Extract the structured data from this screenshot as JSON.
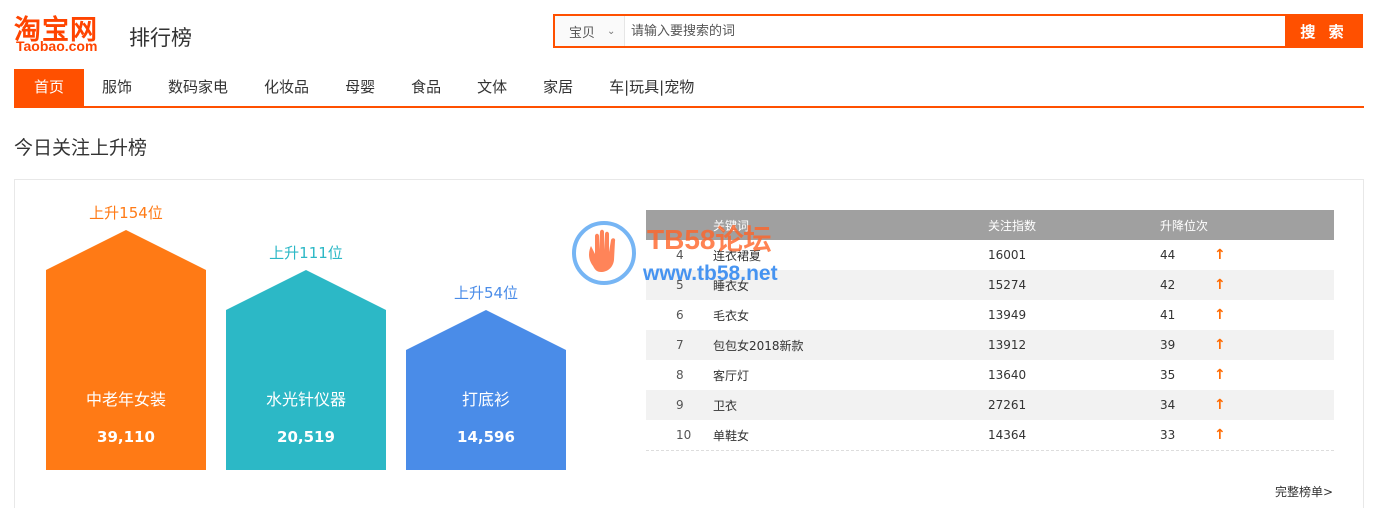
{
  "header": {
    "logo_cn": "淘宝网",
    "logo_en": "Taobao.com",
    "page_name": "排行榜",
    "search": {
      "type_label": "宝贝",
      "placeholder": "请输入要搜索的词",
      "button_label": "搜 索"
    }
  },
  "nav": {
    "items": [
      {
        "label": "首页"
      },
      {
        "label": "服饰"
      },
      {
        "label": "数码家电"
      },
      {
        "label": "化妆品"
      },
      {
        "label": "母婴"
      },
      {
        "label": "食品"
      },
      {
        "label": "文体"
      },
      {
        "label": "家居"
      },
      {
        "label": "车|玩具|宠物"
      }
    ]
  },
  "section": {
    "title": "今日关注上升榜"
  },
  "top3": [
    {
      "rise": "上升154位",
      "name": "中老年女装",
      "count": "39,110",
      "color": "#ff7a15"
    },
    {
      "rise": "上升111位",
      "name": "水光针仪器",
      "count": "20,519",
      "color": "#2cb8c6"
    },
    {
      "rise": "上升54位",
      "name": "打底衫",
      "count": "14,596",
      "color": "#4a8ce8"
    }
  ],
  "table": {
    "headers": [
      "关键词",
      "关注指数",
      "升降位次"
    ],
    "rows": [
      {
        "idx": "4",
        "kw": "连衣裙夏",
        "val": "16001",
        "chg": "44",
        "arrow": "↑"
      },
      {
        "idx": "5",
        "kw": "睡衣女",
        "val": "15274",
        "chg": "42",
        "arrow": "↑"
      },
      {
        "idx": "6",
        "kw": "毛衣女",
        "val": "13949",
        "chg": "41",
        "arrow": "↑"
      },
      {
        "idx": "7",
        "kw": "包包女2018新款",
        "val": "13912",
        "chg": "39",
        "arrow": "↑"
      },
      {
        "idx": "8",
        "kw": "客厅灯",
        "val": "13640",
        "chg": "35",
        "arrow": "↑"
      },
      {
        "idx": "9",
        "kw": "卫衣",
        "val": "27261",
        "chg": "34",
        "arrow": "↑"
      },
      {
        "idx": "10",
        "kw": "单鞋女",
        "val": "14364",
        "chg": "33",
        "arrow": "↑"
      }
    ],
    "more_label": "完整榜单>"
  },
  "watermark": {
    "title": "TB58论坛",
    "url": "www.tb58.net"
  },
  "colors": {
    "accent": "#ff5000"
  }
}
